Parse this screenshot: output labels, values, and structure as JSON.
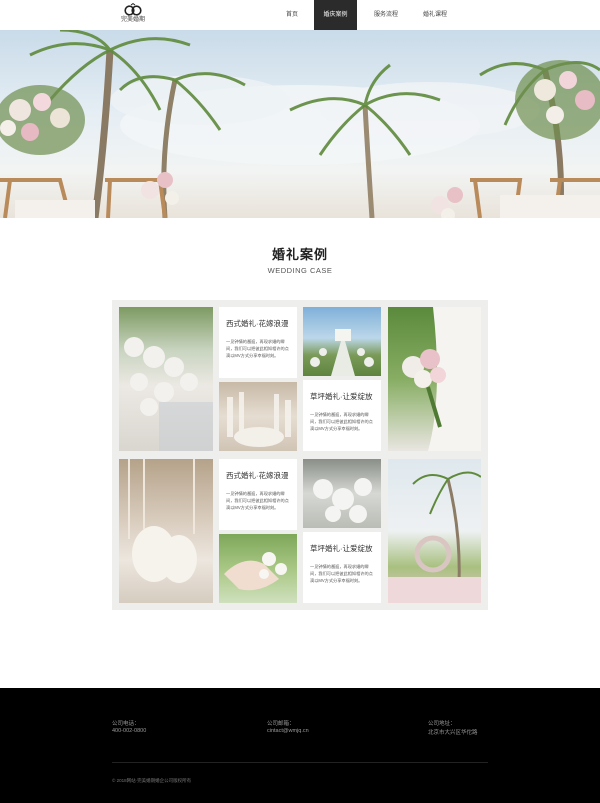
{
  "header": {
    "logo_text": "完美婚期",
    "nav": [
      {
        "label": "首页",
        "active": false
      },
      {
        "label": "婚庆案例",
        "active": true
      },
      {
        "label": "服务流程",
        "active": false
      },
      {
        "label": "婚礼课程",
        "active": false
      }
    ]
  },
  "section": {
    "title": "婚礼案例",
    "subtitle": "WEDDING CASE"
  },
  "cases": [
    {
      "title": "西式婚礼·花嫁浪漫",
      "desc": "一见钟情的邂逅，再现求婚的瞬间，我们可以把彼此相知相许的点滴以MV方式分享幸福时刻。"
    },
    {
      "title": "草坪婚礼·让爱绽放",
      "desc": "一见钟情的邂逅，再现求婚的瞬间，我们可以把彼此相知相许的点滴以MV方式分享幸福时刻。"
    },
    {
      "title": "西式婚礼·花嫁浪漫",
      "desc": "一见钟情的邂逅，再现求婚的瞬间，我们可以把彼此相知相许的点滴以MV方式分享幸福时刻。"
    },
    {
      "title": "草坪婚礼·让爱绽放",
      "desc": "一见钟情的邂逅，再现求婚的瞬间，我们可以把彼此相知相许的点滴以MV方式分享幸福时刻。"
    }
  ],
  "footer": {
    "phone_label": "公司电话：",
    "phone": "400-002-0800",
    "email_label": "公司邮箱：",
    "email": "cintact@wmjq.cn",
    "address_label": "公司地址：",
    "address": "北京市大兴区华佗路",
    "copyright": "© 2018网站·完美婚期婚企公司版权所有"
  },
  "colors": {
    "nav_active_bg": "#2b2b2b",
    "footer_bg": "#000000",
    "gallery_bg": "#eeeeec"
  }
}
